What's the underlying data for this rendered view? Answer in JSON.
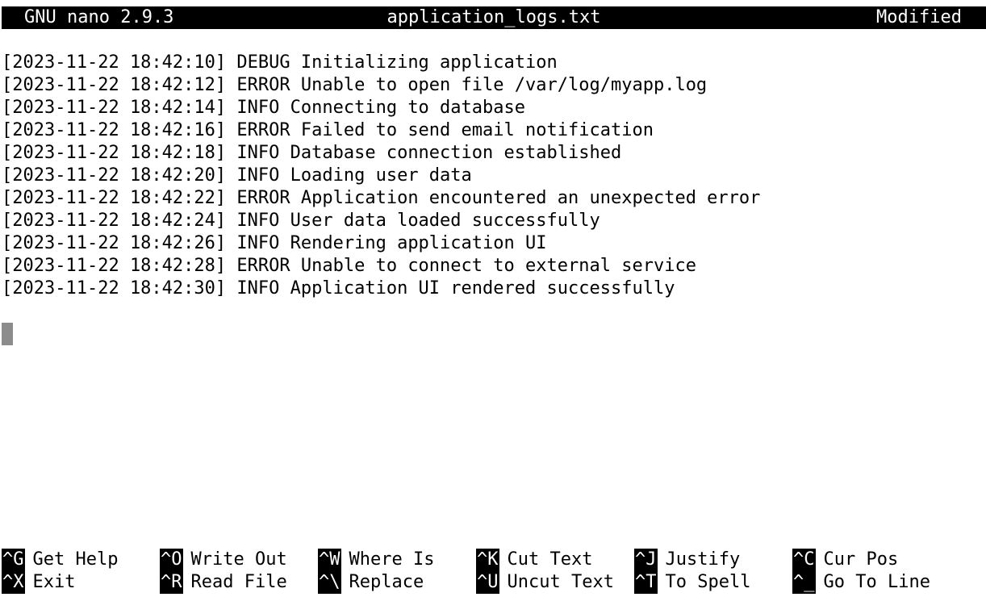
{
  "titlebar": {
    "app_version": "GNU nano 2.9.3",
    "filename": "application_logs.txt",
    "status": "Modified"
  },
  "buffer": {
    "lines": [
      "[2023-11-22 18:42:10] DEBUG Initializing application",
      "[2023-11-22 18:42:12] ERROR Unable to open file /var/log/myapp.log",
      "[2023-11-22 18:42:14] INFO Connecting to database",
      "[2023-11-22 18:42:16] ERROR Failed to send email notification",
      "[2023-11-22 18:42:18] INFO Database connection established",
      "[2023-11-22 18:42:20] INFO Loading user data",
      "[2023-11-22 18:42:22] ERROR Application encountered an unexpected error",
      "[2023-11-22 18:42:24] INFO User data loaded successfully",
      "[2023-11-22 18:42:26] INFO Rendering application UI",
      "[2023-11-22 18:42:28] ERROR Unable to connect to external service",
      "[2023-11-22 18:42:30] INFO Application UI rendered successfully"
    ]
  },
  "shortcuts": {
    "row1": [
      {
        "key": "^G",
        "label": "Get Help"
      },
      {
        "key": "^O",
        "label": "Write Out"
      },
      {
        "key": "^W",
        "label": "Where Is"
      },
      {
        "key": "^K",
        "label": "Cut Text"
      },
      {
        "key": "^J",
        "label": "Justify"
      },
      {
        "key": "^C",
        "label": "Cur Pos"
      }
    ],
    "row2": [
      {
        "key": "^X",
        "label": "Exit"
      },
      {
        "key": "^R",
        "label": "Read File"
      },
      {
        "key": "^\\",
        "label": "Replace"
      },
      {
        "key": "^U",
        "label": "Uncut Text"
      },
      {
        "key": "^T",
        "label": "To Spell"
      },
      {
        "key": "^_",
        "label": "Go To Line"
      }
    ]
  }
}
